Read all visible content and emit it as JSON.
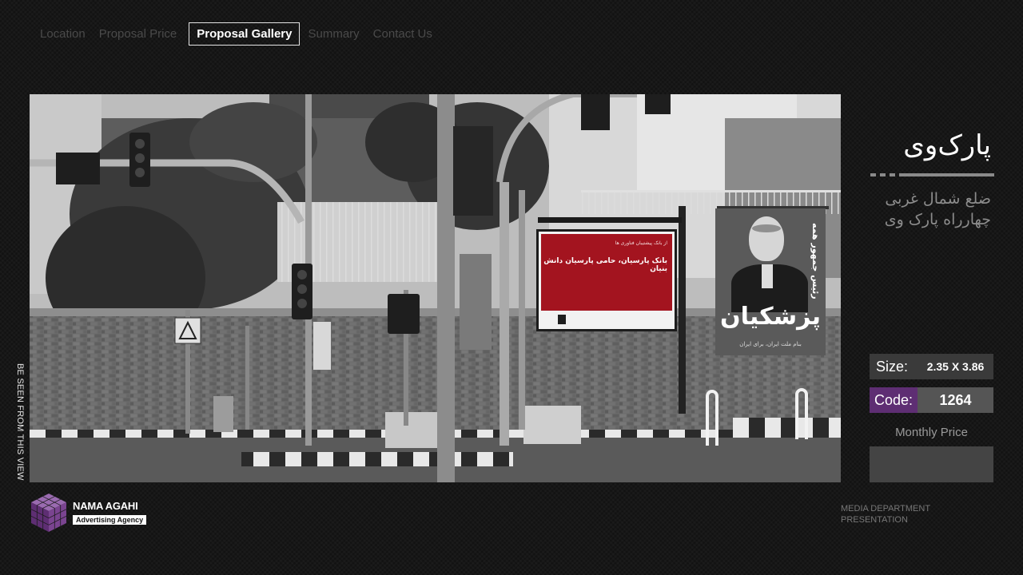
{
  "nav": {
    "items": [
      {
        "label": "Location",
        "active": false
      },
      {
        "label": "Proposal Price",
        "active": false
      },
      {
        "label": "Proposal Gallery",
        "active": true
      },
      {
        "label": "Summary",
        "active": false
      },
      {
        "label": "Contact Us",
        "active": false
      }
    ]
  },
  "photo_caption": "BE SEEN FROM THIS VIEW",
  "billboard": {
    "small_line": "از بانک پیشتیبان فناوری ها",
    "main_line": "بانک پارسیان، حامی پارسیان دانش بنیان"
  },
  "poster": {
    "top_text": "رئیس جمهور همه",
    "name": "پزشکیان",
    "bottom_text": "بنام ملت ایران، برای ایران"
  },
  "location": {
    "title": "پارک‌وی",
    "subtitle_line1": "ضلع شمال غربی",
    "subtitle_line2": "چهارراه پارک وی"
  },
  "size": {
    "label": "Size:",
    "value": "2.35 X 3.86"
  },
  "code": {
    "label": "Code:",
    "value": "1264"
  },
  "monthly_price": {
    "label": "Monthly Price",
    "value": ""
  },
  "logo": {
    "name": "NAMA AGAHI",
    "tagline": "Advertising Agency"
  },
  "footer": {
    "line1": "MEDIA DEPARTMENT",
    "line2": "PRESENTATION"
  },
  "colors": {
    "accent_purple": "#5e2e73",
    "billboard_red": "#a3141f",
    "background": "#121212"
  }
}
